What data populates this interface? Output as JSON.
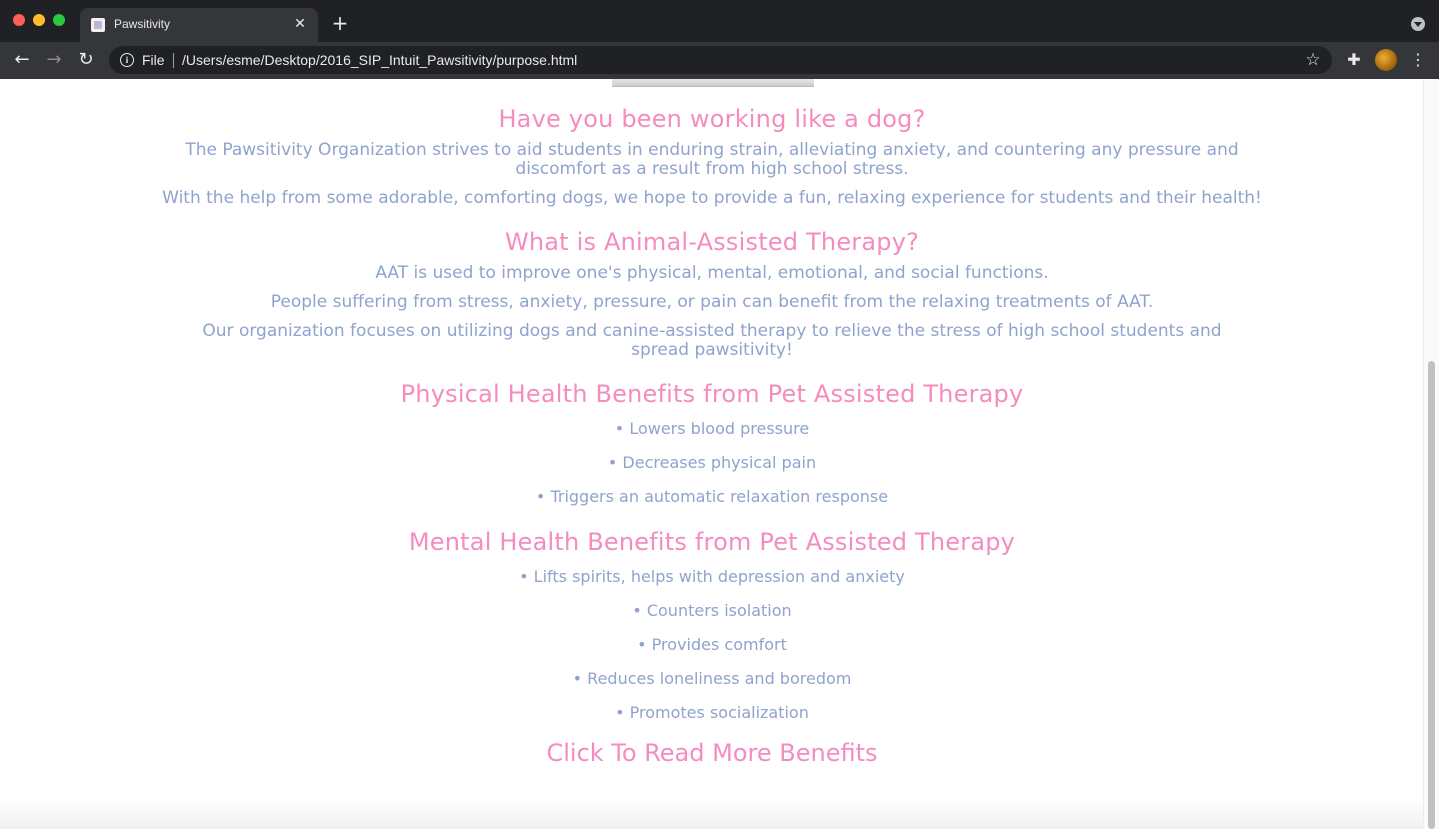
{
  "browser": {
    "tab_title": "Pawsitivity",
    "tab_close_glyph": "✕",
    "new_tab_glyph": "+",
    "scheme_label": "File",
    "url": "/Users/esme/Desktop/2016_SIP_Intuit_Pawsitivity/purpose.html",
    "icons": {
      "back": "←",
      "forward": "→",
      "reload": "↻",
      "info": "i",
      "star": "☆",
      "extensions": "✚",
      "menu": "⋮"
    }
  },
  "colors": {
    "heading_pink": "#f48cbf",
    "body_blue": "#8fa3cc",
    "chrome_dark": "#202124"
  },
  "sections": {
    "intro": {
      "heading": "Have you been working like a dog?",
      "paragraphs": [
        "The Pawsitivity Organization strives to aid students in enduring strain, alleviating anxiety, and countering any pressure and discomfort as a result from high school stress.",
        "With the help from some adorable, comforting dogs, we hope to provide a fun, relaxing experience for students and their health!"
      ]
    },
    "aat": {
      "heading": "What is Animal-Assisted Therapy?",
      "paragraphs": [
        "AAT is used to improve one's physical, mental, emotional, and social functions.",
        "People suffering from stress, anxiety, pressure, or pain can benefit from the relaxing treatments of AAT.",
        "Our organization focuses on utilizing dogs and canine-assisted therapy to relieve the stress of high school students and spread pawsitivity!"
      ]
    },
    "physical": {
      "heading": "Physical Health Benefits from Pet Assisted Therapy",
      "items": [
        "• Lowers blood pressure",
        "• Decreases physical pain",
        "• Triggers an automatic relaxation response"
      ]
    },
    "mental": {
      "heading": "Mental Health Benefits from Pet Assisted Therapy",
      "items": [
        "• Lifts spirits, helps with depression and anxiety",
        "• Counters isolation",
        "• Provides comfort",
        "• Reduces loneliness and boredom",
        "• Promotes socialization"
      ]
    },
    "read_more_link": "Click To Read More Benefits"
  }
}
